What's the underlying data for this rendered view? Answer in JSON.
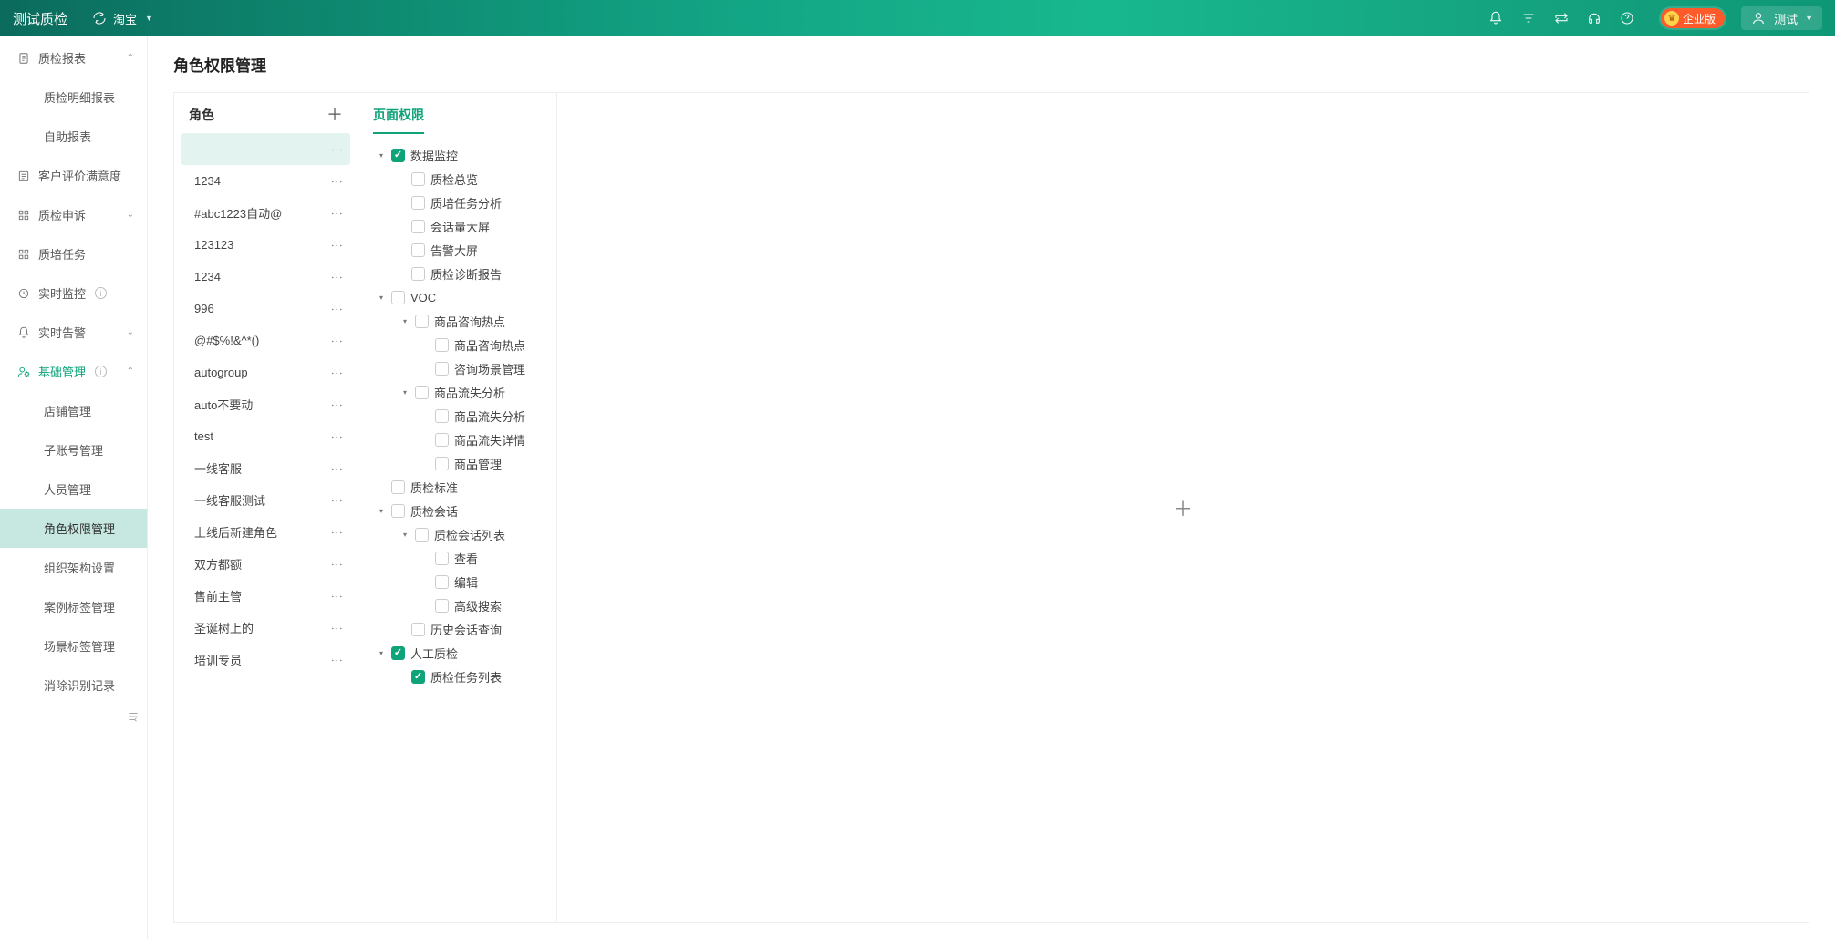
{
  "header": {
    "title": "测试质检",
    "dropdown": "淘宝",
    "badge": "企业版",
    "user": "测试"
  },
  "sidebar": {
    "items": [
      {
        "label": "质检报表",
        "icon": "doc",
        "arrow": "up"
      },
      {
        "label": "质检明细报表",
        "sub": true
      },
      {
        "label": "自助报表",
        "sub": true
      },
      {
        "label": "客户评价满意度",
        "icon": "list"
      },
      {
        "label": "质检申诉",
        "icon": "expand",
        "arrow": "down"
      },
      {
        "label": "质培任务",
        "icon": "expand"
      },
      {
        "label": "实时监控",
        "icon": "clock",
        "info": true
      },
      {
        "label": "实时告警",
        "icon": "bell",
        "arrow": "down"
      },
      {
        "label": "基础管理",
        "icon": "user-cog",
        "arrow": "up",
        "accent": true,
        "info": true
      },
      {
        "label": "店铺管理",
        "sub": true
      },
      {
        "label": "子账号管理",
        "sub": true
      },
      {
        "label": "人员管理",
        "sub": true
      },
      {
        "label": "角色权限管理",
        "sub": true,
        "active": true
      },
      {
        "label": "组织架构设置",
        "sub": true
      },
      {
        "label": "案例标签管理",
        "sub": true
      },
      {
        "label": "场景标签管理",
        "sub": true
      },
      {
        "label": "消除识别记录",
        "sub": true
      }
    ]
  },
  "page": {
    "title": "角色权限管理"
  },
  "roles": {
    "title": "角色",
    "items": [
      {
        "name": "",
        "selected": true
      },
      {
        "name": "1234"
      },
      {
        "name": "#abc1223自动@"
      },
      {
        "name": "123123"
      },
      {
        "name": "1234"
      },
      {
        "name": "996"
      },
      {
        "name": "@#$%!&^*()"
      },
      {
        "name": "autogroup"
      },
      {
        "name": "auto不要动"
      },
      {
        "name": "test"
      },
      {
        "name": "一线客服"
      },
      {
        "name": "一线客服测试"
      },
      {
        "name": "上线后新建角色"
      },
      {
        "name": "双方都额"
      },
      {
        "name": "售前主管"
      },
      {
        "name": "圣诞树上的"
      },
      {
        "name": "培训专员"
      }
    ]
  },
  "tree": {
    "tab": "页面权限",
    "nodes": [
      {
        "depth": 1,
        "caret": true,
        "checked": true,
        "label": "数据监控"
      },
      {
        "depth": 2,
        "label": "质检总览"
      },
      {
        "depth": 2,
        "label": "质培任务分析"
      },
      {
        "depth": 2,
        "label": "会话量大屏"
      },
      {
        "depth": 2,
        "label": "告警大屏"
      },
      {
        "depth": 2,
        "label": "质检诊断报告"
      },
      {
        "depth": 1,
        "caret": true,
        "label": "VOC"
      },
      {
        "depth": 3,
        "caret": true,
        "label": "商品咨询热点"
      },
      {
        "depth": 4,
        "label": "商品咨询热点"
      },
      {
        "depth": 4,
        "label": "咨询场景管理"
      },
      {
        "depth": 3,
        "caret": true,
        "label": "商品流失分析"
      },
      {
        "depth": 4,
        "label": "商品流失分析"
      },
      {
        "depth": 4,
        "label": "商品流失详情"
      },
      {
        "depth": 4,
        "label": "商品管理"
      },
      {
        "depth": 1,
        "label": "质检标准"
      },
      {
        "depth": 1,
        "caret": true,
        "label": "质检会话"
      },
      {
        "depth": 3,
        "caret": true,
        "label": "质检会话列表"
      },
      {
        "depth": 4,
        "label": "查看"
      },
      {
        "depth": 4,
        "label": "编辑"
      },
      {
        "depth": 4,
        "label": "高级搜索"
      },
      {
        "depth": 2,
        "label": "历史会话查询"
      },
      {
        "depth": 1,
        "caret": true,
        "checked": true,
        "label": "人工质检"
      },
      {
        "depth": 2,
        "checked": true,
        "label": "质检任务列表"
      }
    ]
  }
}
